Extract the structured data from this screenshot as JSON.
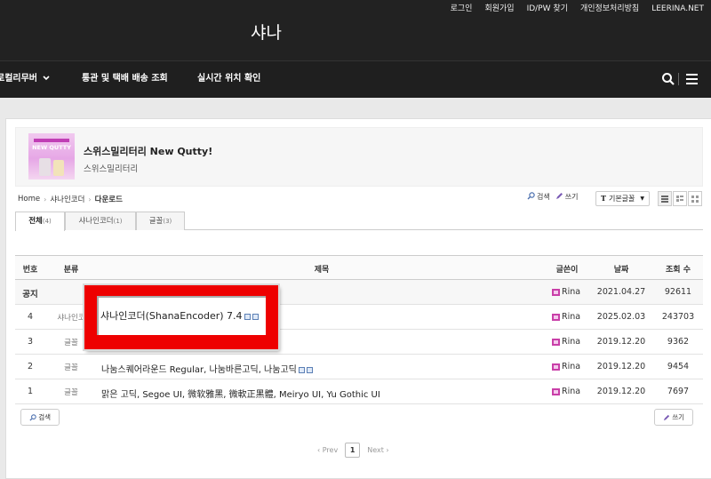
{
  "top_links": [
    "로그인",
    "회원가입",
    "ID/PW 찾기",
    "개인정보처리방침",
    "LEERINA.NET"
  ],
  "site_title": "샤나",
  "nav": {
    "items": [
      "로컬리무버",
      "통관 및 택배 배송 조회",
      "실시간 위치 확인"
    ],
    "search_icon": "search-icon",
    "menu_icon": "hamburger-icon"
  },
  "banner": {
    "title": "스위스밀리터리 New Qutty!",
    "subtitle": "스위스밀리터리",
    "image_text": "NEW QUTTY"
  },
  "breadcrumb": [
    "Home",
    "샤나인코더",
    "다운로드"
  ],
  "tools": {
    "search_label": "검색",
    "write_label": "쓰기",
    "font_select": "기본글꼴",
    "font_prefix": "T"
  },
  "tabs": [
    {
      "label": "전체",
      "count": "(4)"
    },
    {
      "label": "샤나인코더",
      "count": "(1)"
    },
    {
      "label": "글꼴",
      "count": "(3)"
    }
  ],
  "table": {
    "headers": [
      "번호",
      "분류",
      "제목",
      "글쓴이",
      "날짜",
      "조회 수"
    ],
    "rows": [
      {
        "num": "공지",
        "cat": "",
        "title": "",
        "author": "Rina",
        "date": "2021.04.27",
        "views": "92611"
      },
      {
        "num": "4",
        "cat": "샤나인코",
        "title": "",
        "author": "Rina",
        "date": "2025.02.03",
        "views": "243703"
      },
      {
        "num": "3",
        "cat": "글꼴",
        "title": "",
        "author": "Rina",
        "date": "2019.12.20",
        "views": "9362"
      },
      {
        "num": "2",
        "cat": "글꼴",
        "title": "나눔스퀘어라운드 Regular, 나눔바른고딕, 나눔고딕",
        "author": "Rina",
        "date": "2019.12.20",
        "views": "9454"
      },
      {
        "num": "1",
        "cat": "글꼴",
        "title": "맑은 고딕, Segoe UI, 微软雅黑, 微軟正黑體, Meiryo UI, Yu Gothic UI",
        "author": "Rina",
        "date": "2019.12.20",
        "views": "7697"
      }
    ]
  },
  "bottom": {
    "search_label": "검색",
    "write_label": "쓰기"
  },
  "pager": {
    "prev": "‹ Prev",
    "current": "1",
    "next": "Next ›"
  },
  "highlight": {
    "text": "샤나인코더(ShanaEncoder) 7.4",
    "color": "#ee0000"
  }
}
